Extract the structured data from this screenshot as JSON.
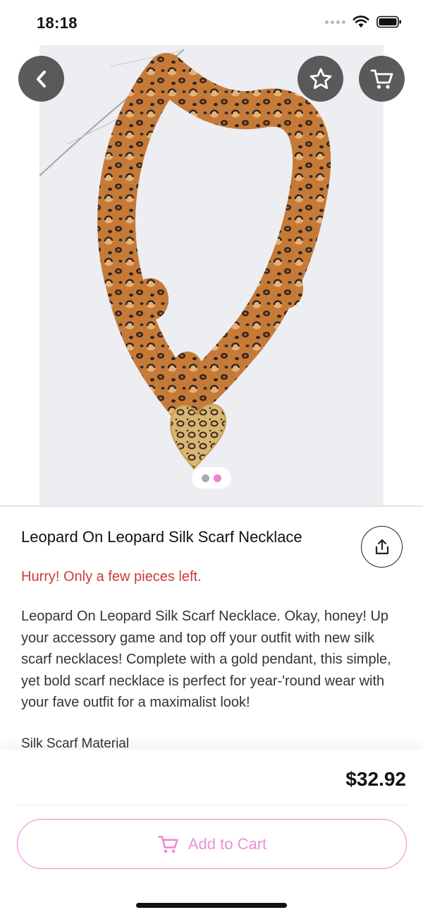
{
  "status_bar": {
    "time": "18:18",
    "icons": [
      "signal-dots-icon",
      "wifi-icon",
      "battery-icon"
    ]
  },
  "top_nav": {
    "icons": [
      "back-chevron-icon",
      "star-icon",
      "cart-icon"
    ]
  },
  "gallery": {
    "page_count": 2,
    "current_page": 2
  },
  "product": {
    "title": "Leopard On Leopard Silk Scarf Necklace",
    "stock_note": "Hurry! Only a few pieces left.",
    "description": "Leopard On Leopard Silk Scarf Necklace. Okay, honey! Up your accessory game and top off your outfit with new silk scarf necklaces! Complete with a gold pendant, this simple, yet bold scarf necklace is perfect for year-'round wear with your fave outfit for a maximalist look!",
    "material": "Silk Scarf Material"
  },
  "purchase": {
    "price": "$32.92",
    "add_to_cart_label": "Add to Cart"
  },
  "colors": {
    "accent_pink": "#f084d4",
    "stock_red": "#cf3a3a",
    "overlay_button": "#404040"
  }
}
